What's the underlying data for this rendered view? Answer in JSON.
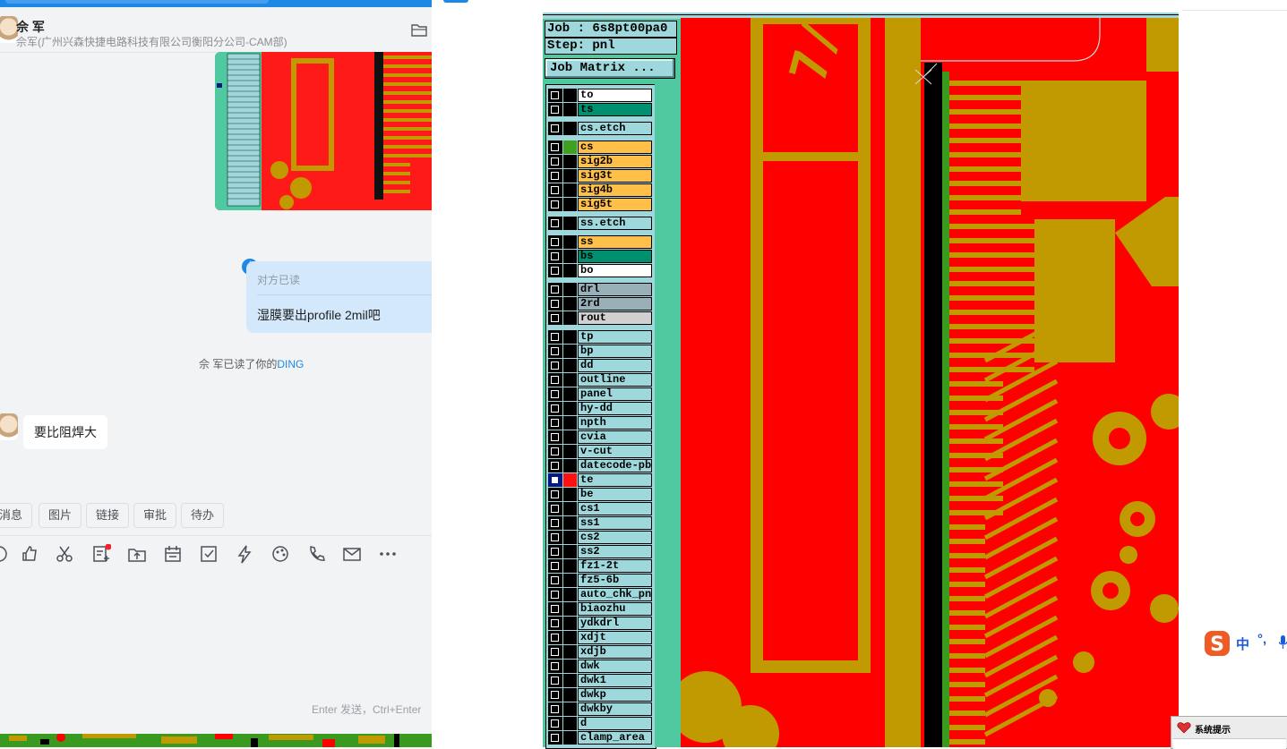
{
  "chat": {
    "header": {
      "name": "佘 军",
      "subtitle": "佘军(广州兴森快捷电路科技有限公司衡阳分公司-CAM部)",
      "folder_icon": "folder-icon"
    },
    "messages": {
      "read_status": "对方已读",
      "outgoing_text": "湿膜要出profile 2mil吧",
      "ding_prefix": "佘 军已读了你的",
      "ding_link": "DING",
      "incoming_text": "要比阻焊大"
    },
    "quick_chips": [
      "消息",
      "图片",
      "链接",
      "审批",
      "待办"
    ],
    "toolbar_icons": [
      "emoji-icon",
      "thumbs-up-icon",
      "scissors-icon",
      "add-note-icon",
      "upload-icon",
      "calendar-icon",
      "checkbox-icon",
      "lightning-icon",
      "palette-icon",
      "phone-icon",
      "mail-icon",
      "more-icon"
    ],
    "send_hint": "Enter 发送，Ctrl+Enter"
  },
  "cam": {
    "job_label": "Job : 6s8pt00pa0",
    "step_label": "Step: pnl",
    "matrix_button": "Job Matrix ...",
    "layers": [
      {
        "name": "to",
        "color": "#ffffff",
        "sw": "#000000"
      },
      {
        "name": "ts",
        "color": "#009070",
        "sw": "#000000"
      },
      {
        "name": "cs.etch",
        "color": "#9fd8dc",
        "sw": "#000000",
        "gap": true
      },
      {
        "name": "cs",
        "color": "#ffc04a",
        "sw": "#40a020",
        "gap": true
      },
      {
        "name": "sig2b",
        "color": "#ffc04a",
        "sw": "#000000"
      },
      {
        "name": "sig3t",
        "color": "#ffc04a",
        "sw": "#000000"
      },
      {
        "name": "sig4b",
        "color": "#ffc04a",
        "sw": "#000000"
      },
      {
        "name": "sig5t",
        "color": "#ffc04a",
        "sw": "#000000"
      },
      {
        "name": "ss.etch",
        "color": "#9fd8dc",
        "sw": "#000000",
        "gap": true
      },
      {
        "name": "ss",
        "color": "#ffc04a",
        "sw": "#000000",
        "gap": true
      },
      {
        "name": "bs",
        "color": "#009070",
        "sw": "#000000"
      },
      {
        "name": "bo",
        "color": "#ffffff",
        "sw": "#000000"
      },
      {
        "name": "drl",
        "color": "#9ab0b8",
        "sw": "#000000",
        "gap": true
      },
      {
        "name": "2rd",
        "color": "#9ab0b8",
        "sw": "#000000"
      },
      {
        "name": "rout",
        "color": "#d0d0d0",
        "sw": "#000000"
      },
      {
        "name": "tp",
        "color": "#9fd8dc",
        "sw": "#000000",
        "gap": true
      },
      {
        "name": "bp",
        "color": "#9fd8dc",
        "sw": "#000000"
      },
      {
        "name": "dd",
        "color": "#9fd8dc",
        "sw": "#000000"
      },
      {
        "name": "outline",
        "color": "#9fd8dc",
        "sw": "#000000"
      },
      {
        "name": "panel",
        "color": "#9fd8dc",
        "sw": "#000000"
      },
      {
        "name": "hy-dd",
        "color": "#9fd8dc",
        "sw": "#000000"
      },
      {
        "name": "npth",
        "color": "#9fd8dc",
        "sw": "#000000"
      },
      {
        "name": "cvia",
        "color": "#9fd8dc",
        "sw": "#000000"
      },
      {
        "name": "v-cut",
        "color": "#9fd8dc",
        "sw": "#000000"
      },
      {
        "name": "datecode-pbe",
        "color": "#9fd8dc",
        "sw": "#000000"
      },
      {
        "name": "te",
        "color": "#9fd8dc",
        "sw": "#ff1010",
        "active": true
      },
      {
        "name": "be",
        "color": "#9fd8dc",
        "sw": "#000000"
      },
      {
        "name": "cs1",
        "color": "#9fd8dc",
        "sw": "#000000"
      },
      {
        "name": "ss1",
        "color": "#9fd8dc",
        "sw": "#000000"
      },
      {
        "name": "cs2",
        "color": "#9fd8dc",
        "sw": "#000000"
      },
      {
        "name": "ss2",
        "color": "#9fd8dc",
        "sw": "#000000"
      },
      {
        "name": "fz1-2t",
        "color": "#9fd8dc",
        "sw": "#000000"
      },
      {
        "name": "fz5-6b",
        "color": "#9fd8dc",
        "sw": "#000000"
      },
      {
        "name": "auto_chk_pnl",
        "color": "#9fd8dc",
        "sw": "#000000"
      },
      {
        "name": "biaozhu",
        "color": "#9fd8dc",
        "sw": "#000000"
      },
      {
        "name": "ydkdrl",
        "color": "#9fd8dc",
        "sw": "#000000"
      },
      {
        "name": "xdjt",
        "color": "#9fd8dc",
        "sw": "#000000"
      },
      {
        "name": "xdjb",
        "color": "#9fd8dc",
        "sw": "#000000"
      },
      {
        "name": "dwk",
        "color": "#9fd8dc",
        "sw": "#000000"
      },
      {
        "name": "dwk1",
        "color": "#9fd8dc",
        "sw": "#000000"
      },
      {
        "name": "dwkp",
        "color": "#9fd8dc",
        "sw": "#000000"
      },
      {
        "name": "dwkby",
        "color": "#9fd8dc",
        "sw": "#000000"
      },
      {
        "name": "d",
        "color": "#9fd8dc",
        "sw": "#000000"
      },
      {
        "name": "clamp_area",
        "color": "#9fd8dc",
        "sw": "#000000"
      }
    ],
    "colors": {
      "board_bg": "#ff0000",
      "copper": "#c09a00",
      "pad_green": "#3a9a20"
    }
  },
  "ime": {
    "label_zh": "中",
    "punct": "°,"
  },
  "system_prompt": {
    "title": "系统提示"
  }
}
